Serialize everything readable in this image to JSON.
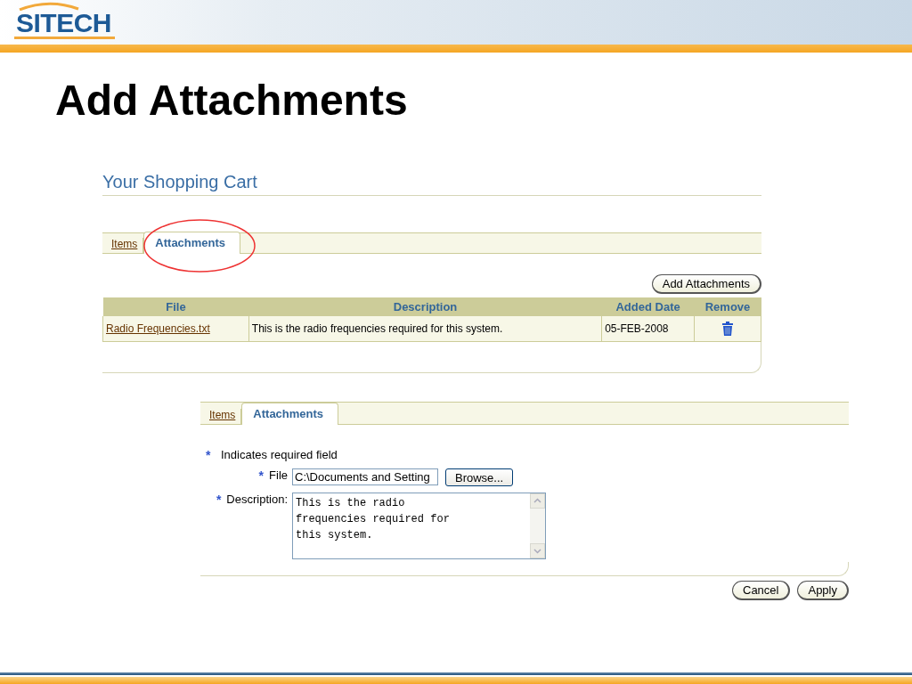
{
  "logo": {
    "text": "SITECH"
  },
  "slide_title": "Add Attachments",
  "cart": {
    "title": "Your Shopping Cart",
    "tabs": [
      {
        "label": "Items",
        "selected": false
      },
      {
        "label": "Attachments",
        "selected": true
      }
    ],
    "add_button": "Add Attachments",
    "table": {
      "columns": [
        "File",
        "Description",
        "Added Date",
        "Remove"
      ],
      "rows": [
        {
          "file": "Radio Frequencies.txt",
          "description": "This is the radio frequencies required for this system.",
          "added_date": "05-FEB-2008"
        }
      ]
    }
  },
  "form": {
    "tabs": [
      {
        "label": "Items",
        "selected": false
      },
      {
        "label": "Attachments",
        "selected": true
      }
    ],
    "required_mark": "*",
    "required_note": "Indicates required field",
    "fields": [
      {
        "kind": "file",
        "label": "File",
        "required": true,
        "value": "C:\\Documents and Setting",
        "button": "Browse..."
      },
      {
        "kind": "textarea",
        "label": "Description:",
        "required": true,
        "value": "This is the radio\nfrequencies required for\nthis system."
      }
    ],
    "buttons": [
      "Cancel",
      "Apply"
    ]
  }
}
